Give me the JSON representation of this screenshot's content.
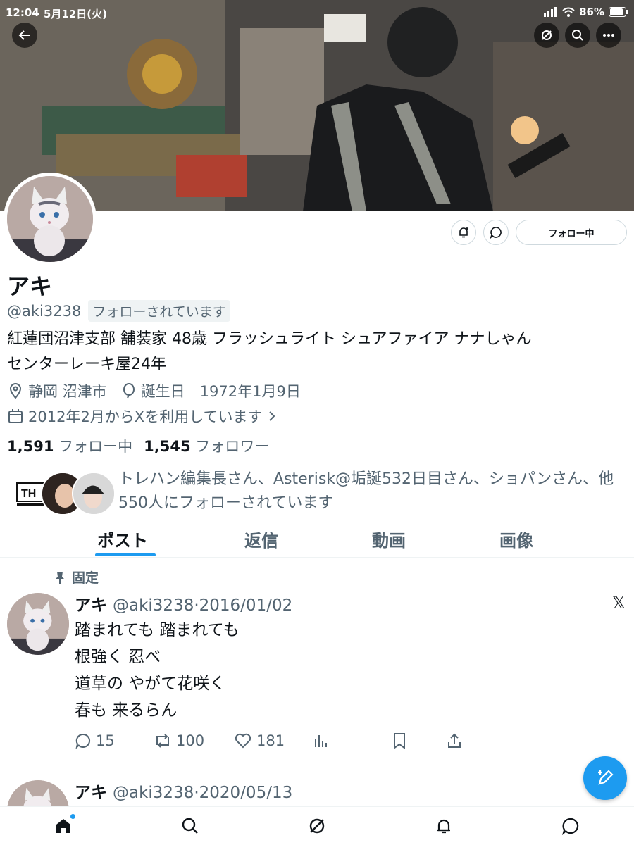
{
  "status_bar": {
    "time": "12:04",
    "date": "5月12日(火)",
    "battery": "86%"
  },
  "header_icons": [
    "back-arrow-icon",
    "grok-icon",
    "search-icon",
    "more-icon"
  ],
  "profile": {
    "name": "アキ",
    "handle": "@aki3238",
    "follows_you": "フォローされています",
    "bio_line1": "紅蓮団沼津支部 舗装家 48歳 フラッシュライト シュアファイア ナナしゃん",
    "bio_line2": "センターレーキ屋24年",
    "location": "静岡 沼津市",
    "birthday": "誕生日　1972年1月9日",
    "joined": "2012年2月からXを利用しています",
    "following_count": "1,591",
    "following_label": "フォロー中",
    "followers_count": "1,545",
    "followers_label": "フォロワー",
    "known_followers_text": "トレハン編集長さん、Asterisk@垢誕532日目さん、ショパンさん、他550人にフォローされています",
    "follow_button": "フォロー中"
  },
  "tabs": [
    "ポスト",
    "返信",
    "動画",
    "画像"
  ],
  "pinned_label": "固定",
  "posts": [
    {
      "name": "アキ",
      "handle_date": "@aki3238·2016/01/02",
      "lines": [
        "踏まれても 踏まれても",
        "根強く 忍べ",
        "道草の やがて花咲く",
        "春も 来るらん"
      ],
      "replies": "15",
      "reposts": "100",
      "likes": "181"
    },
    {
      "name": "アキ",
      "handle_date": "@aki3238·2020/05/13"
    }
  ],
  "colors": {
    "accent": "#1d9bf0",
    "secondary_text": "#536471",
    "primary_text": "#0f1419"
  }
}
